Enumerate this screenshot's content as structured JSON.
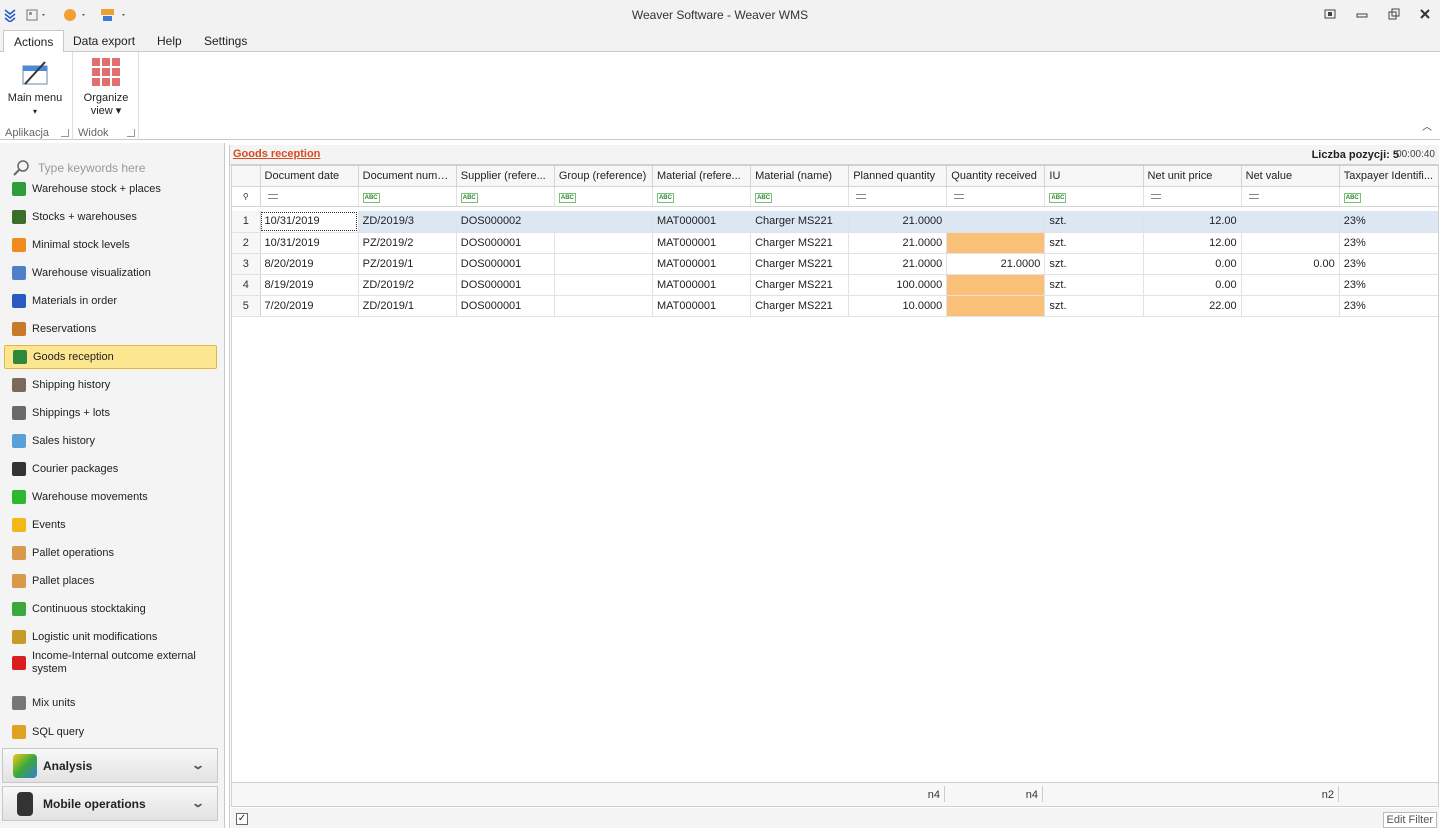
{
  "window": {
    "title": "Weaver Software - Weaver WMS"
  },
  "menu_tabs": [
    "Actions",
    "Data export",
    "Help",
    "Settings"
  ],
  "ribbon": {
    "groups": [
      {
        "label": "Aplikacja",
        "button": {
          "line1": "Main menu",
          "line2": "▾"
        }
      },
      {
        "label": "Widok",
        "button": {
          "line1": "Organize",
          "line2": "view ▾"
        }
      }
    ]
  },
  "sidebar": {
    "search_placeholder": "Type keywords here",
    "items": [
      {
        "label": "Warehouse stock + places",
        "icon": "warehouse-stock-icon",
        "color": "#2e9e3a"
      },
      {
        "label": "Stocks + warehouses",
        "icon": "truck-icon",
        "color": "#3b6e2a"
      },
      {
        "label": "Minimal stock levels",
        "icon": "arrow-down-icon",
        "color": "#f08a1c"
      },
      {
        "label": "Warehouse visualization",
        "icon": "map-icon",
        "color": "#4f7fc8"
      },
      {
        "label": "Materials in order",
        "icon": "flag-icon",
        "color": "#2a5bc0"
      },
      {
        "label": "Reservations",
        "icon": "box-icon",
        "color": "#c87a2a"
      },
      {
        "label": "Goods reception",
        "icon": "truck-icon",
        "color": "#2e8a3a"
      },
      {
        "label": "Shipping history",
        "icon": "pallet-icon",
        "color": "#7a6a5a"
      },
      {
        "label": "Shippings + lots",
        "icon": "boxes-icon",
        "color": "#6a6a6a"
      },
      {
        "label": "Sales history",
        "icon": "layers-icon",
        "color": "#5aa0d8"
      },
      {
        "label": "Courier packages",
        "icon": "plane-icon",
        "color": "#333333"
      },
      {
        "label": "Warehouse movements",
        "icon": "arrow-right-icon",
        "color": "#2eb82e"
      },
      {
        "label": "Events",
        "icon": "lightning-icon",
        "color": "#f2b818"
      },
      {
        "label": "Pallet operations",
        "icon": "pallet-circle-icon",
        "color": "#d89a4a"
      },
      {
        "label": "Pallet places",
        "icon": "pallet-circle-icon",
        "color": "#d89a4a"
      },
      {
        "label": "Continuous stocktaking",
        "icon": "refresh-icon",
        "color": "#3aa83a"
      },
      {
        "label": "Logistic unit modifications",
        "icon": "document-icon",
        "color": "#c89a2a"
      },
      {
        "label": "Income-Internal outcome external system",
        "icon": "exchange-arrows-icon",
        "color": "#d81e1e"
      },
      {
        "label": "Mix units",
        "icon": "mix-units-icon",
        "color": "#777777"
      },
      {
        "label": "SQL query",
        "icon": "sql-icon",
        "color": "#e0a020"
      }
    ],
    "selected_index": 6,
    "groups": [
      {
        "label": "Analysis",
        "icon": "analysis-icon"
      },
      {
        "label": "Mobile operations",
        "icon": "mobile-icon"
      }
    ]
  },
  "panel": {
    "title": "Goods reception",
    "count_label": "Liczba pozycji: 5",
    "timer": "00:00:40"
  },
  "grid": {
    "columns": [
      "Document date",
      "Document number",
      "Supplier (refere...",
      "Group (reference)",
      "Material (refere...",
      "Material (name)",
      "Planned quantity",
      "Quantity received",
      "IU",
      "Net unit price",
      "Net value",
      "Taxpayer Identifi..."
    ],
    "filter_types": [
      "eq",
      "abc",
      "abc",
      "abc",
      "abc",
      "abc",
      "eq",
      "eq",
      "abc",
      "eq",
      "eq",
      "abc"
    ],
    "filter_abc_text": "ABC",
    "rows": [
      {
        "n": "1",
        "cells": [
          "10/31/2019",
          "ZD/2019/3",
          "DOS000002",
          "",
          "MAT000001",
          "Charger MS221",
          "21.0000",
          "",
          "szt.",
          "12.00",
          "",
          "23%"
        ],
        "warn": false
      },
      {
        "n": "2",
        "cells": [
          "10/31/2019",
          "PZ/2019/2",
          "DOS000001",
          "",
          "MAT000001",
          "Charger MS221",
          "21.0000",
          "",
          "szt.",
          "12.00",
          "",
          "23%"
        ],
        "warn": true
      },
      {
        "n": "3",
        "cells": [
          "8/20/2019",
          "PZ/2019/1",
          "DOS000001",
          "",
          "MAT000001",
          "Charger MS221",
          "21.0000",
          "21.0000",
          "szt.",
          "0.00",
          "0.00",
          "23%"
        ],
        "warn": false
      },
      {
        "n": "4",
        "cells": [
          "8/19/2019",
          "ZD/2019/2",
          "DOS000001",
          "",
          "MAT000001",
          "Charger MS221",
          "100.0000",
          "",
          "szt.",
          "0.00",
          "",
          "23%"
        ],
        "warn": true
      },
      {
        "n": "5",
        "cells": [
          "7/20/2019",
          "ZD/2019/1",
          "DOS000001",
          "",
          "MAT000001",
          "Charger MS221",
          "10.0000",
          "",
          "szt.",
          "22.00",
          "",
          "23%"
        ],
        "warn": true
      }
    ],
    "footer": {
      "planned": "n4",
      "received": "n4",
      "net_value": "n2"
    }
  },
  "statusbar": {
    "edit_filter": "Edit Filter",
    "checkbox_mark": "✓"
  },
  "colors": {
    "accent": "#d94a1e",
    "selected": "#fce690",
    "warning_cell": "#fbc077"
  }
}
